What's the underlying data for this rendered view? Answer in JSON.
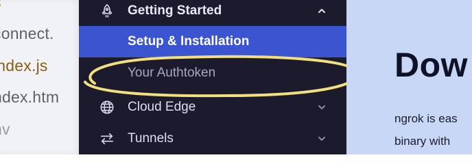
{
  "files": {
    "top_partial": "s",
    "items": [
      {
        "label": "connect.",
        "color": "#5f6068"
      },
      {
        "label": "index.js",
        "color": "#8a5e16"
      },
      {
        "label": "ndex.htm",
        "color": "#5f6068"
      },
      {
        "label": "nv",
        "color": "#9a9ba3"
      }
    ]
  },
  "sidebar": {
    "section": {
      "label": "Getting Started",
      "icon": "rocket-icon",
      "expanded": true
    },
    "subitems": [
      {
        "label": "Setup & Installation",
        "active": true
      },
      {
        "label": "Your Authtoken",
        "active": false,
        "highlighted": true
      }
    ],
    "items": [
      {
        "label": "Cloud Edge",
        "icon": "globe-icon"
      },
      {
        "label": "Tunnels",
        "icon": "arrows-icon"
      }
    ]
  },
  "content": {
    "heading": "Dow",
    "paragraph_lines": [
      "ngrok is eas",
      "binary with"
    ]
  },
  "colors": {
    "sidebar_bg": "#1c1b2e",
    "active_bg": "#3b55d1",
    "highlight": "#f2e07c",
    "content_bg": "#c8d7f6"
  }
}
